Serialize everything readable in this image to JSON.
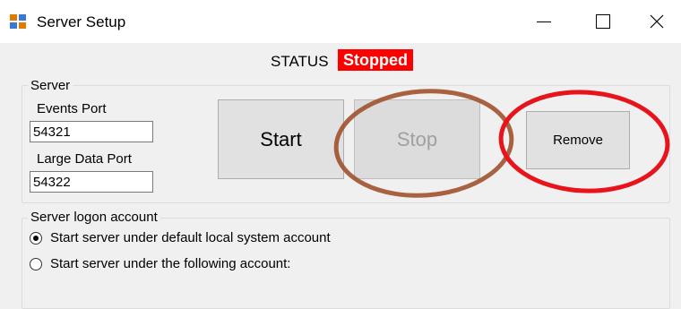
{
  "window": {
    "title": "Server Setup",
    "min_symbol": "",
    "close_symbol": "✕"
  },
  "status": {
    "label": "STATUS",
    "value": "Stopped",
    "badge_color": "#ff0000"
  },
  "server_group": {
    "title": "Server",
    "events_port_label": "Events Port",
    "events_port_value": "54321",
    "large_data_port_label": "Large Data Port",
    "large_data_port_value": "54322"
  },
  "buttons": {
    "start_label": "Start",
    "stop_label": "Stop",
    "remove_label": "Remove"
  },
  "logon_group": {
    "title": "Server logon account",
    "option_default": "Start server under default local system account",
    "option_account": "Start server under the following account:",
    "selected": "default"
  },
  "annotations": {
    "stop_circle_color": "#a0522d",
    "remove_circle_color": "#e8141c"
  },
  "icons": {
    "app": "app-window-icon",
    "minimize": "minimize-icon",
    "maximize": "maximize-icon",
    "close": "close-icon"
  }
}
